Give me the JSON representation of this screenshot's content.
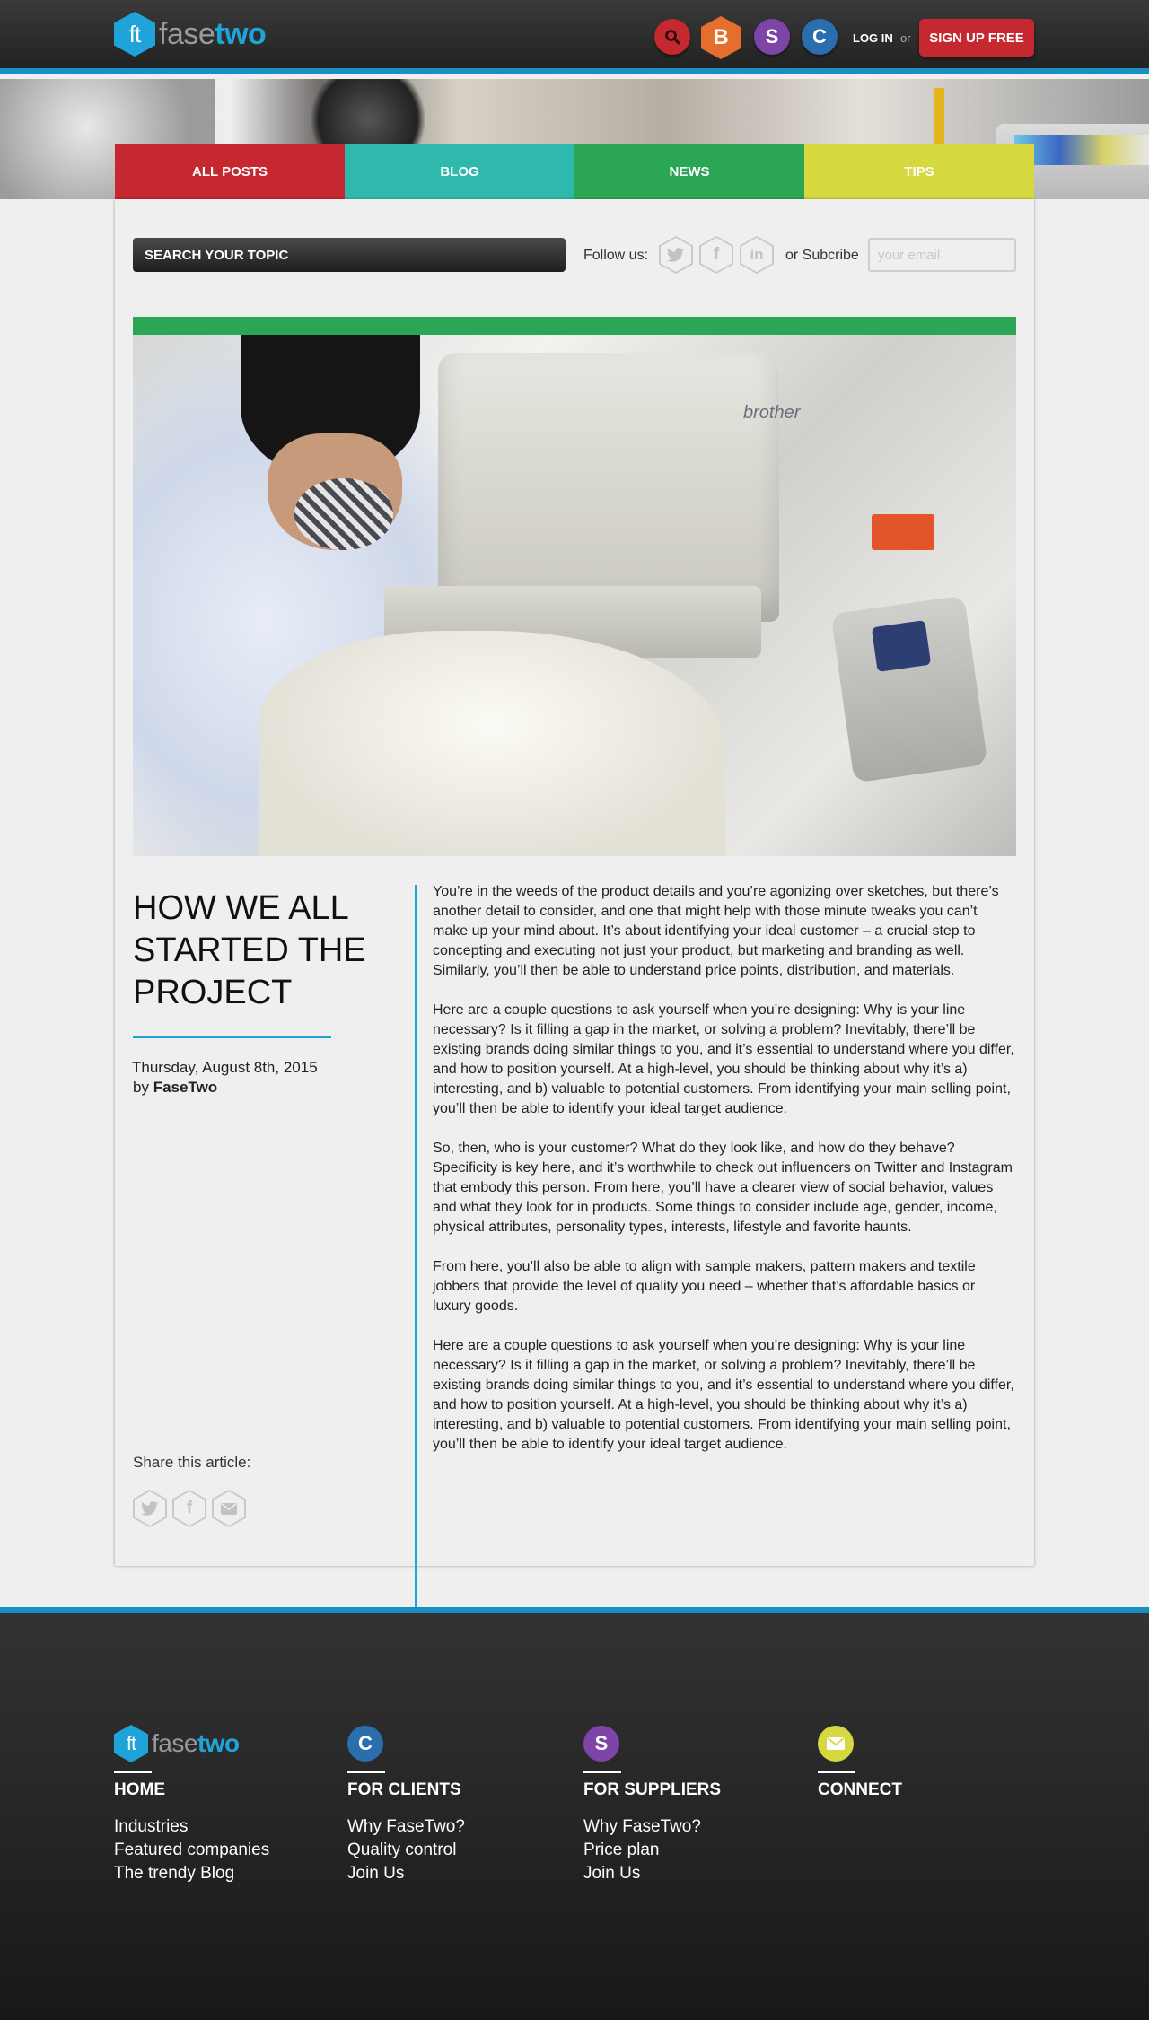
{
  "header": {
    "logo_mark": "ft",
    "logo_word_1": "fase",
    "logo_word_2": "two",
    "icons": {
      "search": "search-icon",
      "buyers": "B",
      "suppliers": "S",
      "clients": "C"
    },
    "login_label": "LOG IN",
    "or_label": "or",
    "signup_label": "SIGN UP FREE"
  },
  "nav": {
    "tabs": [
      {
        "label": "ALL POSTS",
        "color": "#c5282e"
      },
      {
        "label": "BLOG",
        "color": "#2fb9ad"
      },
      {
        "label": "NEWS",
        "color": "#2aa655"
      },
      {
        "label": "TIPS",
        "color": "#d5d83e"
      }
    ]
  },
  "toolbar": {
    "search_label": "SEARCH YOUR TOPIC",
    "follow_label": "Follow us:",
    "subscribe_label": "or Subcribe",
    "email_placeholder": "your email"
  },
  "article": {
    "image_brand_text": "brother",
    "title": "HOW WE ALL STARTED THE PROJECT",
    "date": "Thursday, August 8th, 2015",
    "by_label": "by",
    "author": "FaseTwo",
    "paragraphs": [
      "You’re in the weeds of the product details and you’re agonizing over sketches, but there’s another detail to consider, and one that might help with those minute tweaks you can’t make up your mind about. It’s about identifying your ideal customer – a crucial step to concepting and executing not just your product, but marketing and branding as well. Similarly, you’ll then be able to understand price points, distribution, and materials.",
      "Here are a couple questions to ask yourself when you’re designing: Why is your line necessary? Is it filling a gap in the market, or solving a problem? Inevitably, there’ll be existing brands doing similar things to you, and it’s essential to understand where you differ, and how to position yourself. At a high-level, you should be thinking about why it’s a) interesting, and b) valuable to potential customers. From identifying your main selling point, you’ll then be able to identify your ideal target audience.",
      "So, then, who is your customer? What do they look like, and how do they behave? Specificity is key here, and it’s worthwhile to check out influencers on Twitter and Instagram that embody this person. From here, you’ll have a clearer view of social behavior, values and what they look for in products. Some things to consider include age, gender, income, physical attributes, personality types, interests, lifestyle and favorite haunts.",
      "From here, you’ll also be able to align with sample makers, pattern makers and textile jobbers that provide the level of quality you need – whether that’s affordable basics or luxury goods.",
      "Here are a couple questions to ask yourself when you’re designing: Why is your line necessary? Is it filling a gap in the market, or solving a problem? Inevitably, there’ll be existing brands doing similar things to you, and it’s essential to understand where you differ, and how to position yourself. At a high-level, you should be thinking about why it’s a) interesting, and b) valuable to potential customers. From identifying your main selling point, you’ll then be able to identify your ideal target audience."
    ],
    "share_label": "Share this article:"
  },
  "footer": {
    "columns": [
      {
        "icon": "ft",
        "heading": "HOME",
        "links": [
          "Industries",
          "Featured companies",
          "The trendy Blog"
        ]
      },
      {
        "icon": "C",
        "icon_color": "#2a6eae",
        "heading": "FOR CLIENTS",
        "links": [
          "Why FaseTwo?",
          "Quality control",
          "Join Us"
        ]
      },
      {
        "icon": "S",
        "icon_color": "#7f44a8",
        "heading": "FOR SUPPLIERS",
        "links": [
          "Why FaseTwo?",
          "Price plan",
          "Join Us"
        ]
      },
      {
        "icon": "mail-icon",
        "icon_color": "#d5d83e",
        "heading": "CONNECT",
        "links": []
      }
    ]
  },
  "colors": {
    "accent": "#1ea4d8",
    "header_rule": "#1a8fc2",
    "danger": "#c5282e"
  }
}
